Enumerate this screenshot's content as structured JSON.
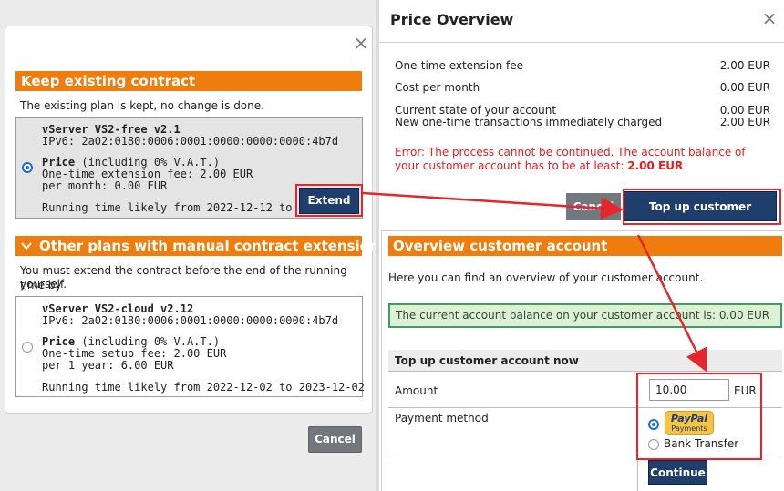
{
  "left_dialog": {
    "close_icon": "×",
    "keep_section": {
      "title": "Keep existing contract",
      "description": "The existing plan is kept, no change is done.",
      "plan": {
        "name": "vServer VS2-free v2.1",
        "ipv6": "IPv6: 2a02:0180:0006:0001:0000:0000:0000:4b7d",
        "price_label": "Price",
        "price_note": "(including 0% V.A.T.)",
        "fee_line": "One-time extension fee: 2.00 EUR",
        "period_line": "per month: 0.00 EUR",
        "running_time": "Running time likely from 2022-12-12 to 2023-01-",
        "selected": true
      },
      "extend_label": "Extend"
    },
    "other_section": {
      "chevron_icon": "chevron-down-icon",
      "title": "Other plans with manual contract extension",
      "description_line1": "You must extend the contract before the end of the running time by",
      "description_line2": "yourself.",
      "plan": {
        "name": "vServer VS2-cloud v2.12",
        "ipv6": "IPv6: 2a02:0180:0006:0001:0000:0000:0000:4b7d",
        "price_label": "Price",
        "price_note": "(including 0% V.A.T.)",
        "fee_line": "One-time setup fee: 2.00 EUR",
        "period_line": "per 1 year: 6.00 EUR",
        "running_time": "Running time likely from 2022-12-02 to 2023-12-02",
        "selected": false
      }
    },
    "cancel_label": "Cancel"
  },
  "price_overview": {
    "title": "Price Overview",
    "close_icon": "×",
    "rows": [
      {
        "label": "One-time extension fee",
        "value": "2.00 EUR"
      },
      {
        "label": "Cost per month",
        "value": "0.00 EUR"
      },
      {
        "label": "Current state of your account",
        "value": "0.00 EUR"
      },
      {
        "label": "New one-time transactions immediately charged",
        "value": "2.00 EUR"
      }
    ],
    "error_text": "Error: The process cannot be continued. The account balance of your customer account has to be at least:",
    "error_amount": "2.00 EUR",
    "cancel_label": "Cancel",
    "topup_label": "Top up customer account"
  },
  "account_overview": {
    "title": "Overview customer account",
    "intro": "Here you can find an overview of your customer account.",
    "balance_text": "The current account balance on your customer account is: 0.00 EUR",
    "topup_header": "Top up customer account now",
    "amount_label": "Amount",
    "amount_value": "10.00",
    "amount_unit": "EUR",
    "payment_label": "Payment method",
    "paypal_word": "PayPal",
    "paypal_sub": "Payments",
    "paypal_selected": true,
    "bank_label": "Bank Transfer",
    "continue_label": "Continue"
  },
  "colors": {
    "orange": "#ee7d0d",
    "navy": "#1f3e6b",
    "highlight_red": "#e6262d",
    "error_red": "#e81a1a",
    "success_green": "#3c9f5a"
  }
}
